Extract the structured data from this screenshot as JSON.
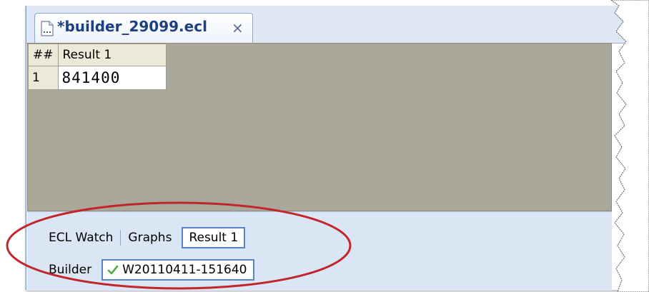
{
  "editor": {
    "tab_title": "*builder_29099.ecl",
    "tab_close_symbol": "×",
    "tab_icon": "ecl-file-icon"
  },
  "results": {
    "columns": [
      "##",
      "Result 1"
    ],
    "rows": [
      {
        "num": "1",
        "value": "841400"
      }
    ]
  },
  "bottom_tabs": {
    "row1": {
      "ecl_watch": "ECL Watch",
      "graphs": "Graphs",
      "result": "Result 1"
    },
    "row2": {
      "label": "Builder",
      "workunit": "W20110411-151640",
      "status_icon": "check-icon"
    }
  },
  "colors": {
    "highlight": "#c0262b",
    "tab_title": "#1e3f83",
    "grid_background": "#a9a89a",
    "panel_background": "#dbe6f4",
    "check": "#4caf3a"
  }
}
